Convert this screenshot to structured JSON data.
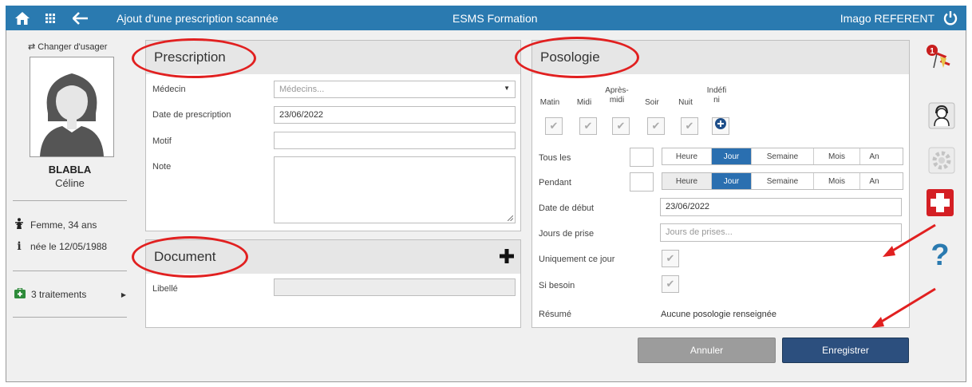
{
  "topbar": {
    "title": "Ajout d'une prescription scannée",
    "center": "ESMS Formation",
    "user": "Imago REFERENT",
    "bg_color": "#2a7ab0"
  },
  "sidebar": {
    "change_user": "Changer d'usager",
    "last_name": "BLABLA",
    "first_name": "Céline",
    "sex_age": "Femme, 34 ans",
    "birth": "née le 12/05/1988",
    "treatments": "3 traitements"
  },
  "prescription": {
    "title": "Prescription",
    "medecin_label": "Médecin",
    "medecin_placeholder": "Médecins...",
    "date_label": "Date de prescription",
    "date_value": "23/06/2022",
    "motif_label": "Motif",
    "note_label": "Note"
  },
  "document": {
    "title": "Document",
    "libelle_label": "Libellé"
  },
  "posologie": {
    "title": "Posologie",
    "moments": [
      "Matin",
      "Midi",
      "Après-\nmidi",
      "Soir",
      "Nuit",
      "Indéfi\nni"
    ],
    "tous_les_label": "Tous les",
    "pendant_label": "Pendant",
    "units": [
      "Heure",
      "Jour",
      "Semaine",
      "Mois",
      "An"
    ],
    "date_debut_label": "Date de début",
    "date_debut_value": "23/06/2022",
    "jours_label": "Jours de prise",
    "jours_placeholder": "Jours de prises...",
    "uniquement_label": "Uniquement ce jour",
    "si_besoin_label": "Si besoin",
    "resume_label": "Résumé",
    "resume_value": "Aucune posologie renseignée"
  },
  "actions": {
    "cancel": "Annuler",
    "save": "Enregistrer"
  },
  "right_bar": {
    "notification_count": "1"
  },
  "colors": {
    "accent": "#2a6fb0",
    "annotation": "#e12020",
    "save": "#2c4f7e"
  }
}
